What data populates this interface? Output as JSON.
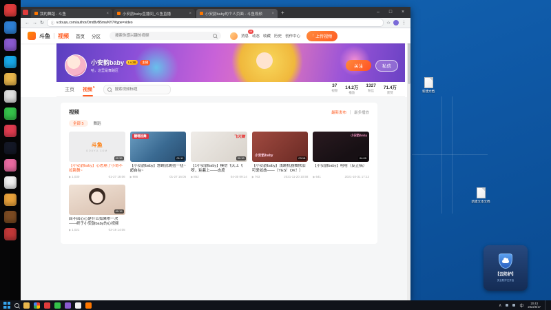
{
  "browser": {
    "tabs": [
      "我的舞蹈 - 斗鱼",
      "小安韵baby直播间_斗鱼直播",
      "小安韵baby的个人页面 - 斗鱼视频"
    ],
    "url": "v.douyu.com/author/0md8vB5mwNY7#type=video",
    "new_tab": "+",
    "controls": {
      "min": "–",
      "max": "□",
      "close": "×"
    }
  },
  "icons": {
    "back": "←",
    "forward": "→",
    "reload": "↻",
    "info": "ⓘ",
    "star": "☆",
    "menu": "⋮",
    "close": "×",
    "play": "▶",
    "upload_arrow": "↑",
    "tray_up": "∧"
  },
  "douyu": {
    "logo_main": "斗鱼",
    "logo_sub": "视频",
    "nav": [
      "首页",
      "分区"
    ],
    "search_placeholder": "搜索你感兴趣的视频",
    "message_badge": "48",
    "user_items": [
      "消息",
      "动态",
      "收藏",
      "历史",
      "创作中心"
    ],
    "upload_button": "上传视频"
  },
  "profile": {
    "name": "小安韵baby",
    "level": "Lv.38",
    "role": "主播",
    "desc": "哈，这里是舞蹈区",
    "follow_button": "关注",
    "message_button": "私信"
  },
  "page_tabs": {
    "home": "主页",
    "video": "视频",
    "video_count": "5",
    "search_placeholder": "搜索视频标题"
  },
  "stats": [
    {
      "value": "37",
      "label": "视频"
    },
    {
      "value": "14.2万",
      "label": "播放"
    },
    {
      "value": "1327",
      "label": "粉丝"
    },
    {
      "value": "71.4万",
      "label": "获赞"
    }
  ],
  "section": {
    "title": "视频",
    "sort_new": "最新发布",
    "sort_hot": "最多播放",
    "filter_all": "全部 5",
    "filter_dance": "舞蹈"
  },
  "videos": [
    {
      "title": "【小安韵baby】心态崩了小哥不如跳舞~",
      "views": "1,030",
      "date": "01-27 18:06",
      "duration": "02:39",
      "thumb_label": "斗鱼",
      "thumb_sub": "DOUYU.COM"
    },
    {
      "title": "【小安韵baby】想跳就跳扭一扭~超自在~",
      "views": "986",
      "date": "01-27 16:05",
      "duration": "01:11",
      "thumb_label": "翻唱热舞"
    },
    {
      "title": "【1小安韵baby】模仿飞天上飞呀，粘着上——态度",
      "views": "852",
      "date": "04-30 09:14",
      "duration": "00:30",
      "thumb_label": "飞天舞"
    },
    {
      "title": "【小安韵baby】浅跳机器舞依旧可爱如故——（YES！OK！）",
      "views": "763",
      "date": "2021-11-20 10:58",
      "duration": "03:18",
      "thumb_label": "小安韵baby"
    },
    {
      "title": "【小安韵baby】哈哈（反正搞）",
      "views": "641",
      "date": "2021-10-31 17:12",
      "duration": "04:09",
      "thumb_label": "小安韵baby"
    },
    {
      "title": "回不回心心是什么如果乖一次——终于小安韵baby的心视频",
      "views": "1,021",
      "date": "03-19 14:05",
      "duration": "00:15",
      "thumb_label": ""
    }
  ],
  "desktop": {
    "shortcut1": "新建文档",
    "shortcut2": "新建文本文档",
    "shield_title": "【云防护】",
    "shield_sub": "安全防护已开启"
  },
  "taskbar": {
    "lang": "中",
    "time": "20:43",
    "date": "2022/5/17"
  }
}
